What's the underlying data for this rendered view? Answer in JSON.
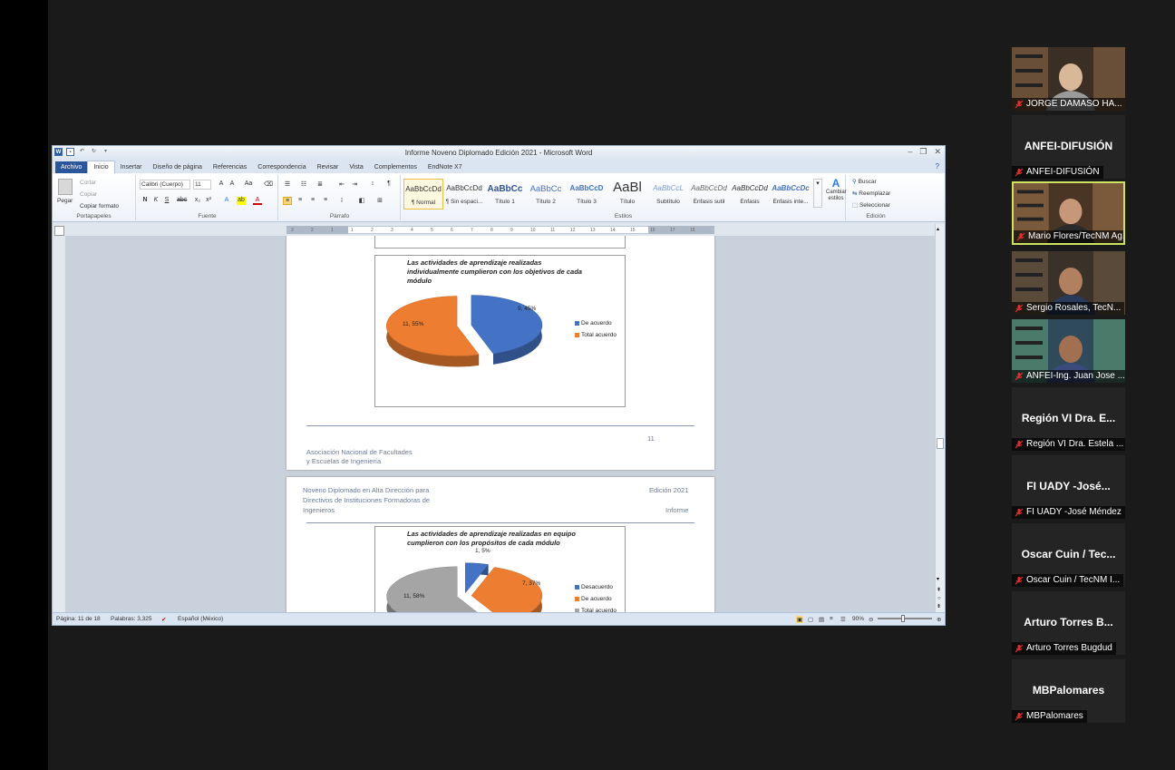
{
  "window": {
    "title": "Informe Noveno Diplomado Edición 2021  -  Microsoft Word",
    "controls": [
      "–",
      "❐",
      "✕"
    ]
  },
  "tabs": [
    "Archivo",
    "Inicio",
    "Insertar",
    "Diseño de página",
    "Referencias",
    "Correspondencia",
    "Revisar",
    "Vista",
    "Complementos",
    "EndNote X7"
  ],
  "ribbon": {
    "clipboard": {
      "paste": "Pegar",
      "cut": "Cortar",
      "copy": "Copiar",
      "format_painter": "Copiar formato",
      "label": "Portapapeles"
    },
    "font": {
      "name": "Calibri (Cuerpo)",
      "size": "11",
      "label": "Fuente"
    },
    "paragraph": {
      "label": "Párrafo"
    },
    "styles": {
      "label": "Estilos",
      "items": [
        {
          "preview": "AaBbCcDd",
          "name": "¶ Normal"
        },
        {
          "preview": "AaBbCcDd",
          "name": "¶ Sin espaci..."
        },
        {
          "preview": "AaBbCc",
          "name": "Título 1"
        },
        {
          "preview": "AaBbCc",
          "name": "Título 2"
        },
        {
          "preview": "AaBbCcD",
          "name": "Título 3"
        },
        {
          "preview": "AaBl",
          "name": "Título"
        },
        {
          "preview": "AaBbCcL",
          "name": "Subtítulo"
        },
        {
          "preview": "AaBbCcDd",
          "name": "Énfasis sutil"
        },
        {
          "preview": "AaBbCcDd",
          "name": "Énfasis"
        },
        {
          "preview": "AaBbCcDc",
          "name": "Énfasis inte..."
        }
      ],
      "change": "Cambiar estilos"
    },
    "editing": {
      "find": "Buscar",
      "replace": "Reemplazar",
      "select": "Seleccionar",
      "label": "Edición"
    }
  },
  "ruler": {
    "ticks": [
      "3",
      "2",
      "1",
      "1",
      "2",
      "3",
      "4",
      "5",
      "6",
      "7",
      "8",
      "9",
      "10",
      "11",
      "12",
      "13",
      "14",
      "15",
      "16",
      "17",
      "18"
    ]
  },
  "page1": {
    "chart": {
      "title": "Las actividades de aprendizaje realizadas individualmente cumplieron con los objetivos de cada módulo",
      "label_a": "9, 45%",
      "label_b": "11, 55%",
      "legend": [
        "De acuerdo",
        "Total acuerdo"
      ]
    },
    "page_number": "11",
    "footer": [
      "Asociación Nacional de Facultades",
      "y Escuelas de Ingeniería"
    ]
  },
  "page2": {
    "header_left": [
      "Noveno Diplomado en Alta Dirección para",
      "Directivos de Instituciones Formadoras de",
      "Ingenieros"
    ],
    "header_right": [
      "Edición 2021",
      "Informe"
    ],
    "chart": {
      "title": "Las actividades de aprendizaje realizadas en equipo cumplieron con los propósitos de cada módulo",
      "label_a": "1, 5%",
      "label_b": "7, 37%",
      "label_c": "11, 58%",
      "legend": [
        "Desacuerdo",
        "De acuerdo",
        "Total acuerdo"
      ]
    }
  },
  "chart_data": [
    {
      "type": "pie",
      "title": "Las actividades de aprendizaje realizadas individualmente cumplieron con los objetivos de cada módulo",
      "categories": [
        "De acuerdo",
        "Total acuerdo"
      ],
      "values": [
        9,
        11
      ],
      "percent": [
        45,
        55
      ],
      "colors": [
        "#4472c4",
        "#ed7d31"
      ],
      "legend": "right"
    },
    {
      "type": "pie",
      "title": "Las actividades de aprendizaje realizadas en equipo cumplieron con los propósitos de cada módulo",
      "categories": [
        "Desacuerdo",
        "De acuerdo",
        "Total acuerdo"
      ],
      "values": [
        1,
        7,
        11
      ],
      "percent": [
        5,
        37,
        58
      ],
      "colors": [
        "#4472c4",
        "#ed7d31",
        "#a5a5a5"
      ],
      "legend": "right"
    }
  ],
  "statusbar": {
    "page": "Página: 11 de 18",
    "words": "Palabras: 3,325",
    "language": "Español (México)",
    "zoom": "90%"
  },
  "participants": [
    {
      "caption": "JORGE DAMASO HA...",
      "name": "",
      "video": true,
      "speaking": false
    },
    {
      "caption": "ANFEI-DIFUSIÓN",
      "name": "ANFEI-DIFUSIÓN",
      "video": false,
      "speaking": false
    },
    {
      "caption": "Mario Flores/TecNM Ag...",
      "name": "",
      "video": true,
      "speaking": true
    },
    {
      "caption": "Sergio Rosales, TecN...",
      "name": "",
      "video": true,
      "speaking": false
    },
    {
      "caption": "ANFEI-Ing. Juan Jose ...",
      "name": "",
      "video": true,
      "speaking": false
    },
    {
      "caption": "Región VI Dra. Estela ...",
      "name": "Región VI Dra. E...",
      "video": false,
      "speaking": false
    },
    {
      "caption": "FI UADY -José Méndez",
      "name": "FI UADY -José...",
      "video": false,
      "speaking": false
    },
    {
      "caption": "Oscar Cuin / TecNM I...",
      "name": "Oscar Cuin / Tec...",
      "video": false,
      "speaking": false
    },
    {
      "caption": "Arturo Torres Bugdud",
      "name": "Arturo Torres B...",
      "video": false,
      "speaking": false
    },
    {
      "caption": "MBPalomares",
      "name": "MBPalomares",
      "video": false,
      "speaking": false
    }
  ]
}
